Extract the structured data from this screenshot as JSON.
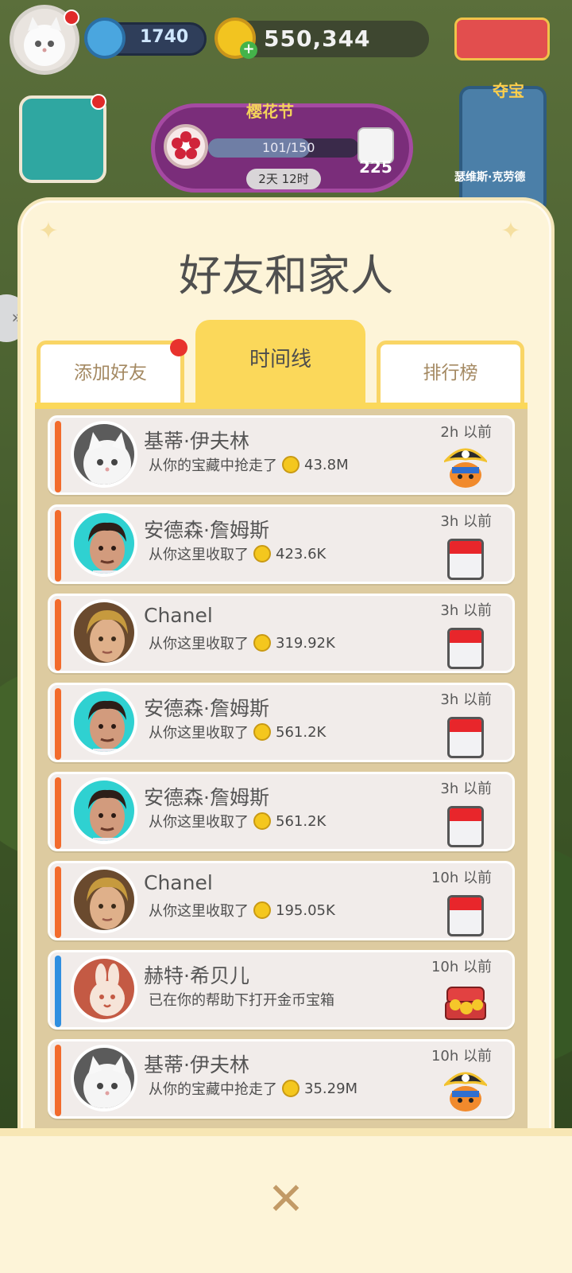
{
  "hud": {
    "level": "1740",
    "coins": "550,344",
    "event_title": "樱花节",
    "event_progress": "101/150",
    "event_progress_fraction": 0.673,
    "event_timer": "2天 12时",
    "dice_count": "225",
    "raid_label": "夺宝",
    "raid_player": "瑟维斯·克劳德"
  },
  "modal": {
    "title": "好友和家人",
    "tabs": [
      {
        "label": "添加好友"
      },
      {
        "label": "时间线"
      },
      {
        "label": "排行榜"
      }
    ]
  },
  "feed": [
    {
      "name": "基蒂·伊夫林",
      "desc": "从你的宝藏中抢走了",
      "amount": "43.8M",
      "time": "2h 以前",
      "icon": "pirate-icon",
      "accent": "#f26b2c",
      "avatar": "kitten"
    },
    {
      "name": "安德森·詹姆斯",
      "desc": "从你这里收取了",
      "amount": "423.6K",
      "time": "3h 以前",
      "icon": "calendar-icon",
      "accent": "#f26b2c",
      "avatar": "man-teal"
    },
    {
      "name": "Chanel",
      "desc": "从你这里收取了",
      "amount": "319.92K",
      "time": "3h 以前",
      "icon": "calendar-icon",
      "accent": "#f26b2c",
      "avatar": "boy-blond"
    },
    {
      "name": "安德森·詹姆斯",
      "desc": "从你这里收取了",
      "amount": "561.2K",
      "time": "3h 以前",
      "icon": "calendar-icon",
      "accent": "#f26b2c",
      "avatar": "man-teal"
    },
    {
      "name": "安德森·詹姆斯",
      "desc": "从你这里收取了",
      "amount": "561.2K",
      "time": "3h 以前",
      "icon": "calendar-icon",
      "accent": "#f26b2c",
      "avatar": "man-teal"
    },
    {
      "name": "Chanel",
      "desc": "从你这里收取了",
      "amount": "195.05K",
      "time": "10h 以前",
      "icon": "calendar-icon",
      "accent": "#f26b2c",
      "avatar": "boy-blond"
    },
    {
      "name": "赫特·希贝儿",
      "desc": "已在你的帮助下打开金币宝箱",
      "amount": "",
      "time": "10h 以前",
      "icon": "chest-icon",
      "accent": "#2f8fe0",
      "avatar": "rabbit-logo"
    },
    {
      "name": "基蒂·伊夫林",
      "desc": "从你的宝藏中抢走了",
      "amount": "35.29M",
      "time": "10h 以前",
      "icon": "pirate-icon",
      "accent": "#f26b2c",
      "avatar": "kitten"
    }
  ],
  "bottom": {
    "close": "✕"
  }
}
